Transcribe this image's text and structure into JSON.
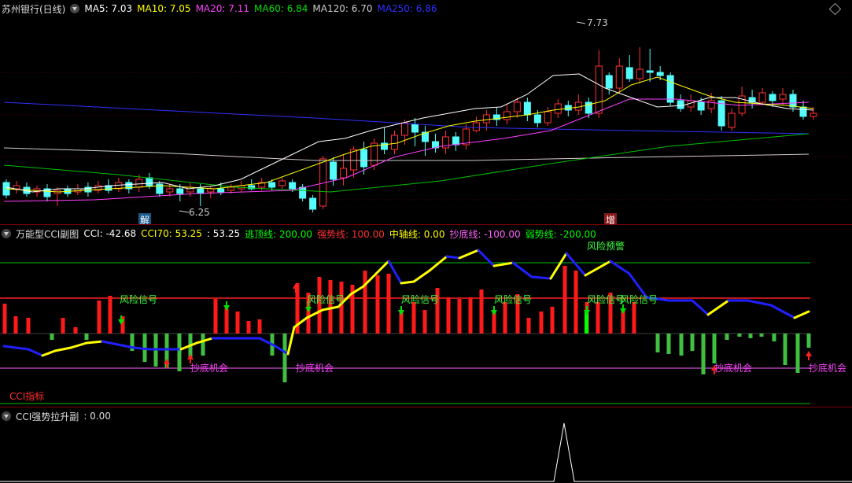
{
  "main_panel": {
    "title": "苏州银行(日线)",
    "ma": [
      {
        "label": "MA5: 7.03",
        "color": "#ffffff"
      },
      {
        "label": "MA10: 7.05",
        "color": "#ffff00"
      },
      {
        "label": "MA20: 7.11",
        "color": "#ff40ff"
      },
      {
        "label": "MA60: 6.84",
        "color": "#00e000"
      },
      {
        "label": "MA120: 6.70",
        "color": "#cccccc"
      },
      {
        "label": "MA250: 6.86",
        "color": "#3030ff"
      }
    ],
    "high_label": "7.73",
    "low_label": "6.25",
    "badge_left": "解",
    "badge_right": "增"
  },
  "cci_panel": {
    "title": "万能型CCI副图",
    "values": [
      {
        "label": "CCI: -42.68",
        "color": "#ffffff"
      },
      {
        "label": "CCI70: 53.25",
        "color": "#ffff00"
      },
      {
        "label": ": 53.25",
        "color": "#ffffff"
      },
      {
        "label": "逃顶线: 200.00",
        "color": "#00ff00"
      },
      {
        "label": "强势线: 100.00",
        "color": "#ff3030"
      },
      {
        "label": "中轴线: 0.00",
        "color": "#ffff00"
      },
      {
        "label": "抄底线: -100.00",
        "color": "#ff60ff"
      },
      {
        "label": "弱势线: -200.00",
        "color": "#00ff00"
      }
    ],
    "risk_warning": "风险预警",
    "risk_signal": "风险信号",
    "bottom_chance": "抄底机会",
    "indicator_label": "CCI指标"
  },
  "lift_panel": {
    "title": "CCI强势拉升副",
    "value": ": 0.00"
  },
  "colors": {
    "up": "#ff3232",
    "down": "#54fcfc",
    "ma5": "#ffffff",
    "ma10": "#ffff00",
    "ma20": "#ff40ff",
    "ma60": "#00c000",
    "ma120": "#cccccc",
    "ma250": "#3030ff"
  }
}
